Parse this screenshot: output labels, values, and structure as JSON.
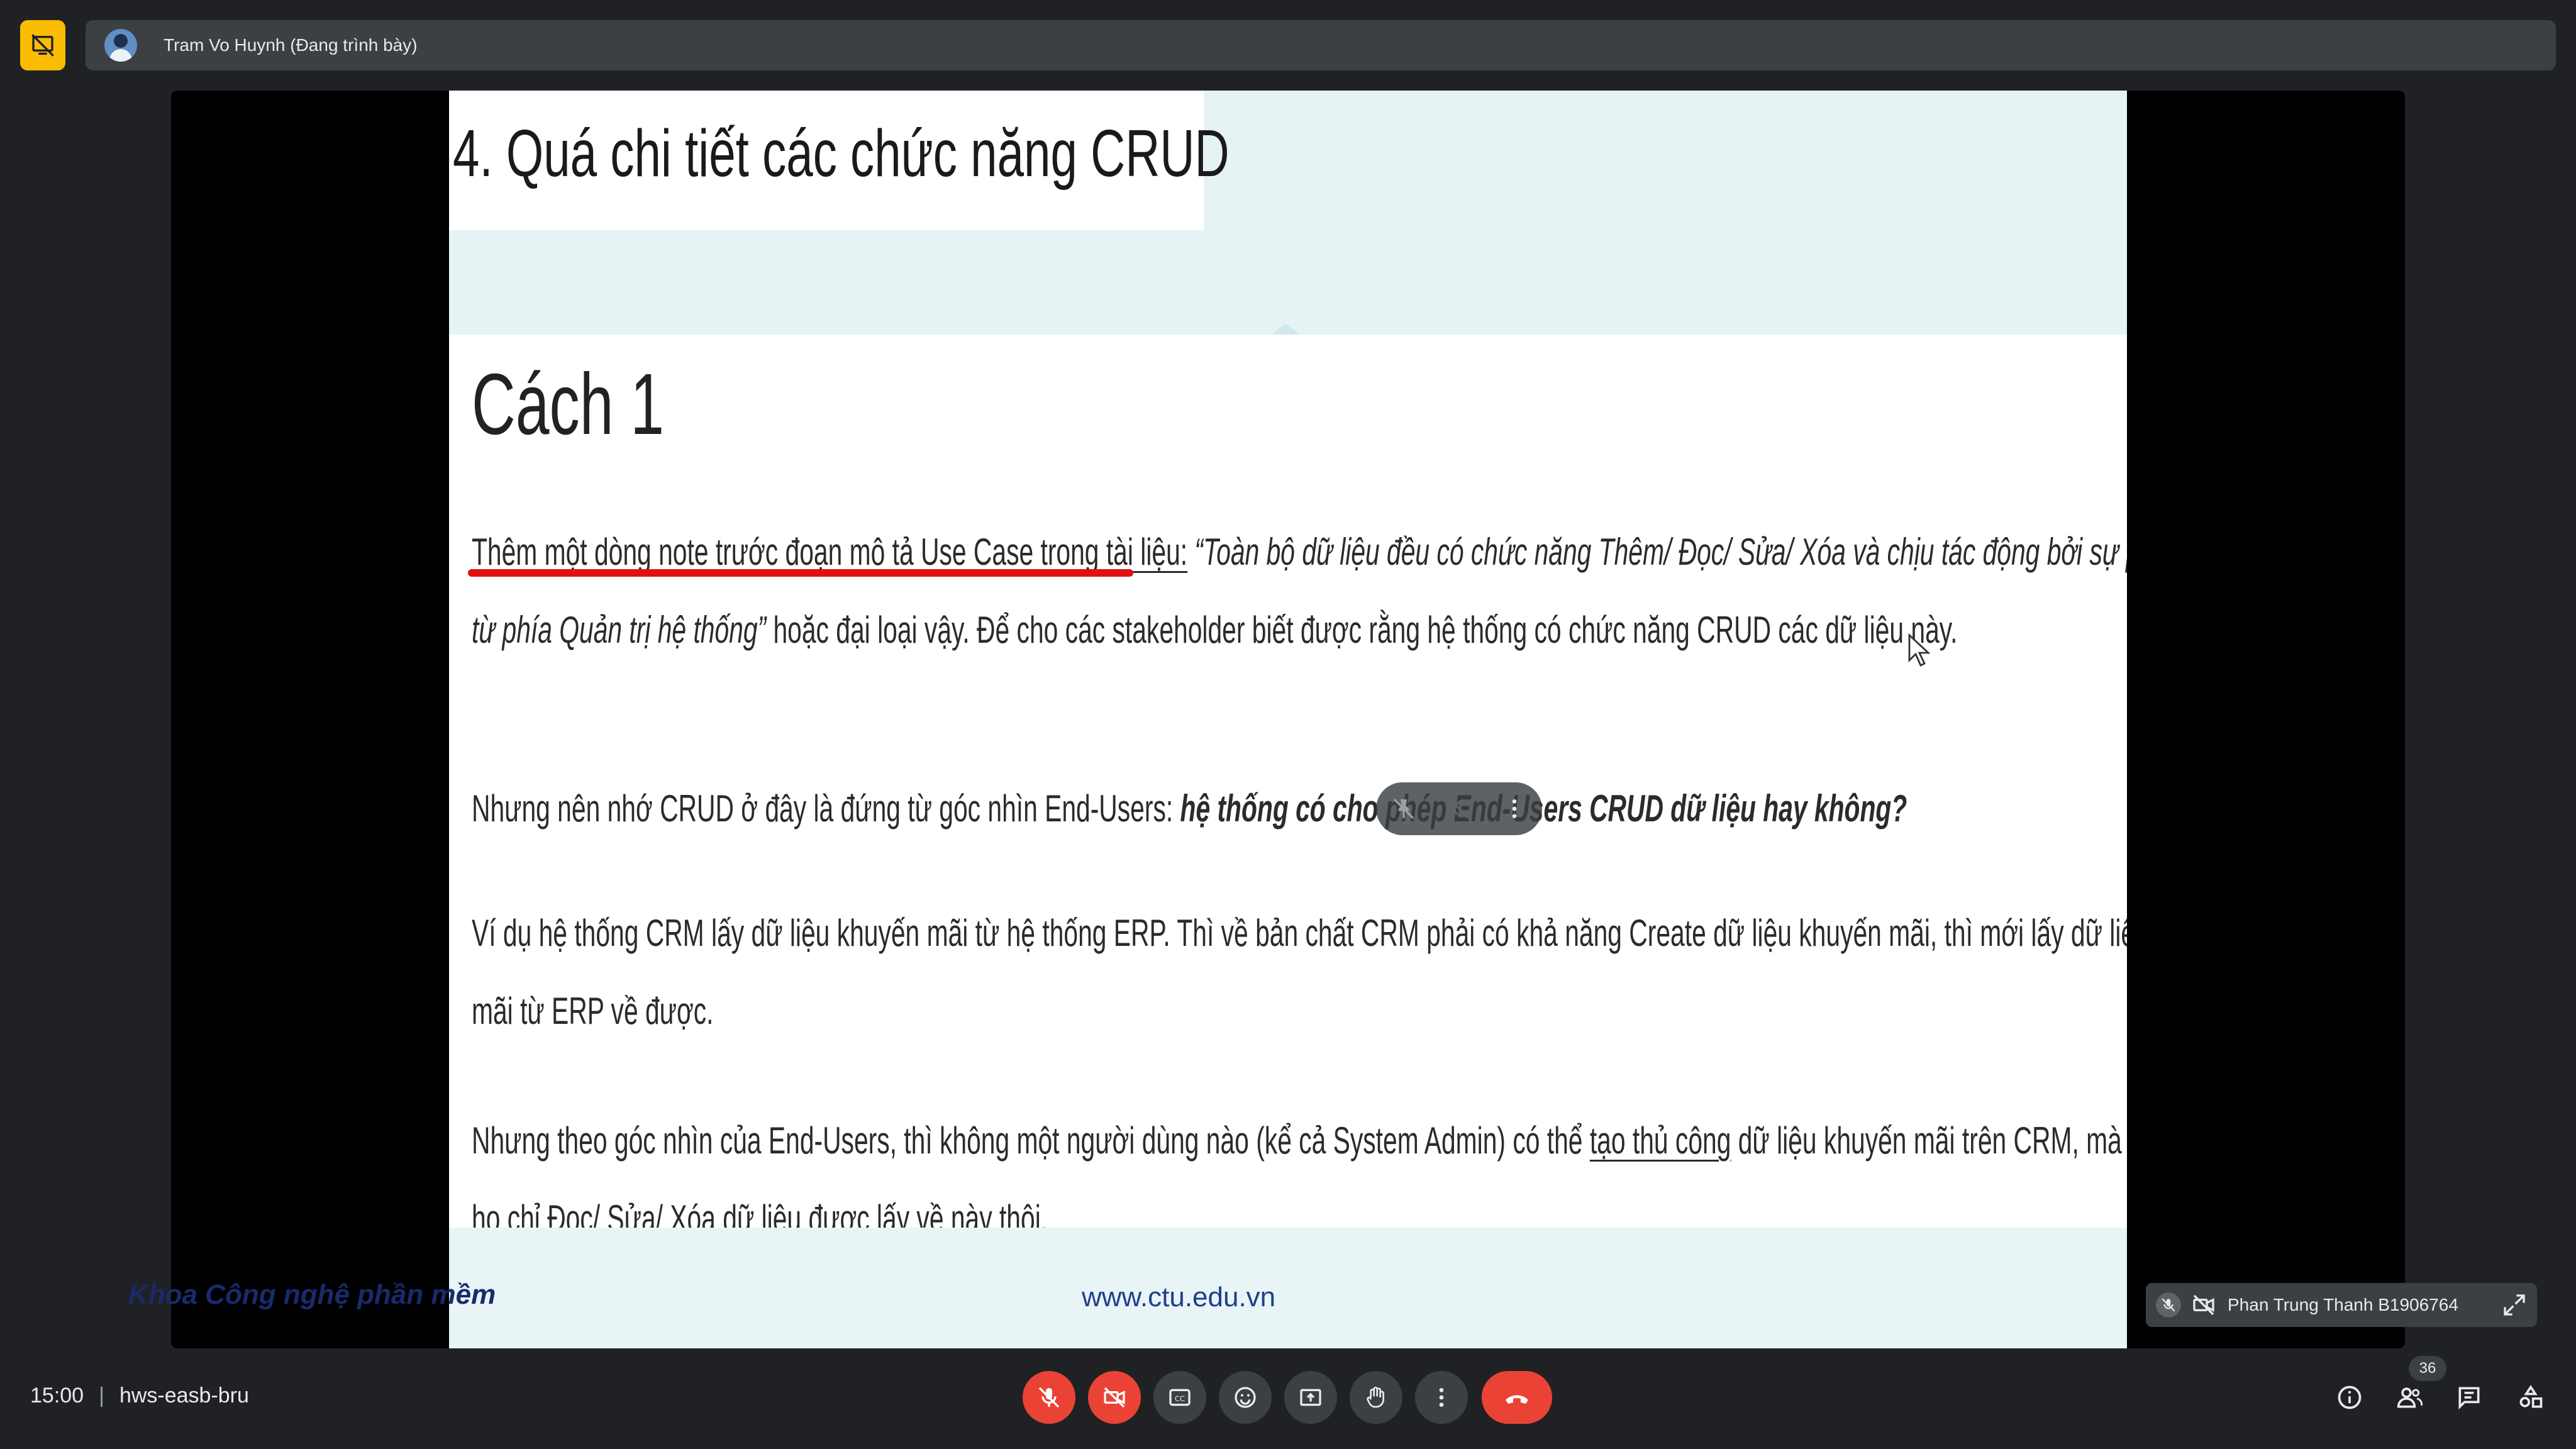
{
  "presenter": {
    "name": "Tram Vo Huynh (Đang trình bày)"
  },
  "slide": {
    "title": "4. Quá chi tiết các chức năng CRUD",
    "heading": "Cách 1",
    "para1": {
      "underlined": "Thêm một dòng note trước đoạn mô tả Use Case trong tài liệu:",
      "italic_line1": " “Toàn bộ dữ liệu đều có chức năng Thêm/ Đọc/ Sửa/ Xóa và chịu tác động bởi sự phân quyền",
      "italic_line2": "từ phía Quản trị hệ thống”",
      "rest_line2": " hoặc đại loại vậy. Để cho các stakeholder biết được rằng hệ thống có chức năng CRUD các dữ liệu này."
    },
    "para2": {
      "prefix": "Nhưng nên nhớ CRUD ở đây là đứng từ góc nhìn End-Users: ",
      "bold": "hệ thống có cho phép End-Users CRUD dữ liệu hay không?"
    },
    "para3": {
      "line1": "Ví dụ hệ thống CRM lấy dữ liệu khuyến mãi từ hệ thống ERP. Thì về bản chất CRM phải có khả năng Create dữ liệu khuyến mãi, thì mới lấy dữ liệu khuyến",
      "line2": "mãi từ ERP về được."
    },
    "para4": {
      "line1_pre": "Nhưng theo góc nhìn của End-Users, thì không một người dùng nào (kể cả System Admin) có thể ",
      "line1_ul": "tạo thủ công",
      "line1_post": " dữ liệu khuyến mãi trên CRM, mà End-Users",
      "line2": "họ chỉ Đọc/ Sửa/ Xóa dữ liệu được lấy về này thôi."
    },
    "footer": {
      "department": "Khoa Công nghệ phần mềm",
      "url": "www.ctu.edu.vn"
    }
  },
  "participant_tile": {
    "name": "Phan Trung Thanh B1906764"
  },
  "bottom_bar": {
    "time": "15:00",
    "meeting_code": "hws-easb-bru",
    "people_count": "36"
  },
  "colors": {
    "background": "#202124",
    "control": "#3c4043",
    "danger": "#ea4335",
    "present_badge": "#fbbc04"
  }
}
